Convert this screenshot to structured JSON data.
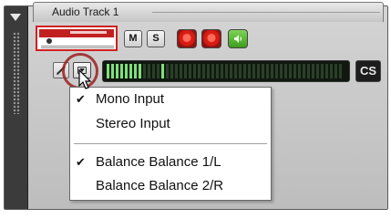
{
  "track": {
    "title": "Audio Track 1"
  },
  "buttons": {
    "mute": "M",
    "solo": "S",
    "cs": "CS"
  },
  "meter": {
    "active_segments": [
      0,
      1,
      2,
      3,
      4,
      5,
      6,
      7,
      12
    ]
  },
  "menu": {
    "items": [
      {
        "label": "Mono Input",
        "checked": true
      },
      {
        "label": "Stereo Input",
        "checked": false
      },
      {
        "label": "Balance Balance 1/L",
        "checked": true
      },
      {
        "label": "Balance Balance 2/R",
        "checked": false
      }
    ]
  },
  "colors": {
    "record_red": "#d81c12",
    "monitor_green": "#4caf2a",
    "meter_on": "#7fe07a",
    "highlight_circle": "#9a2020"
  },
  "icons": {
    "collapse": "collapse-triangle-icon",
    "pencil": "pencil-icon",
    "dropdown": "input-dropdown-icon",
    "speaker": "speaker-icon",
    "cursor": "mouse-cursor-icon"
  }
}
